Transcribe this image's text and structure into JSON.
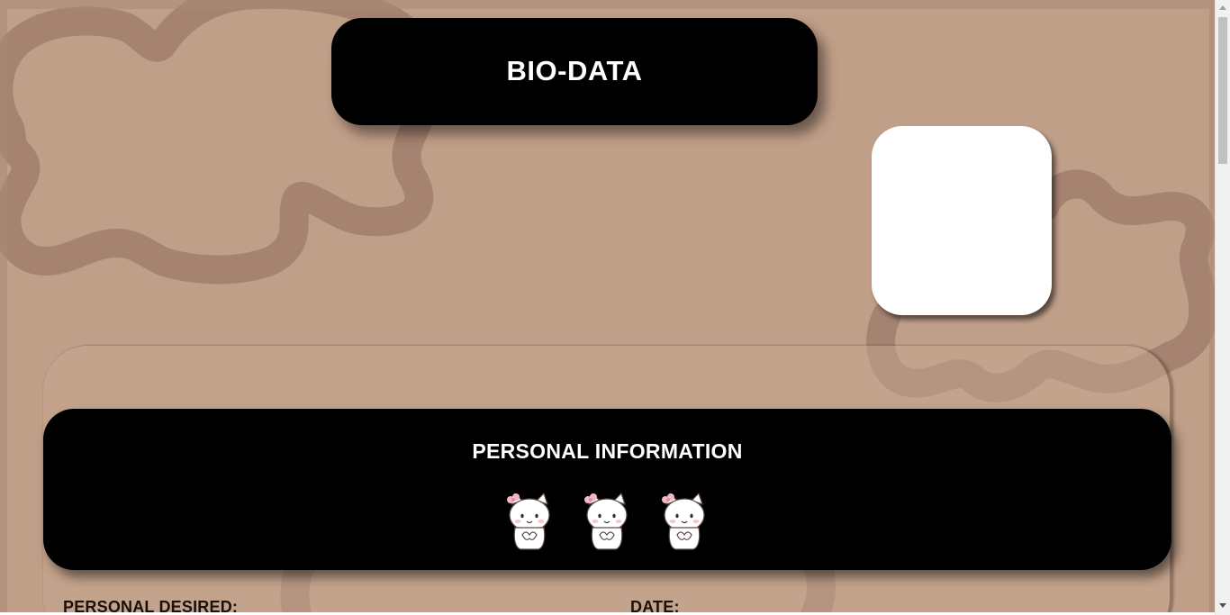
{
  "header": {
    "title": "BIO-DATA"
  },
  "photo": {
    "icon": "photo-placeholder"
  },
  "section": {
    "title": "PERSONAL INFORMATION",
    "decorations": [
      "cat-sticker",
      "cat-sticker",
      "cat-sticker"
    ]
  },
  "fields": {
    "personal_desired_label": "PERSONAL DESIRED:",
    "date_label": "DATE:"
  },
  "colors": {
    "background": "#c09f88",
    "blob": "#a48270",
    "card": "#000000",
    "text_light": "#ffffff",
    "text_dark": "#1a110c"
  },
  "scrollbar": {
    "up_icon": "scroll-up-arrow",
    "down_icon": "scroll-down-arrow"
  }
}
